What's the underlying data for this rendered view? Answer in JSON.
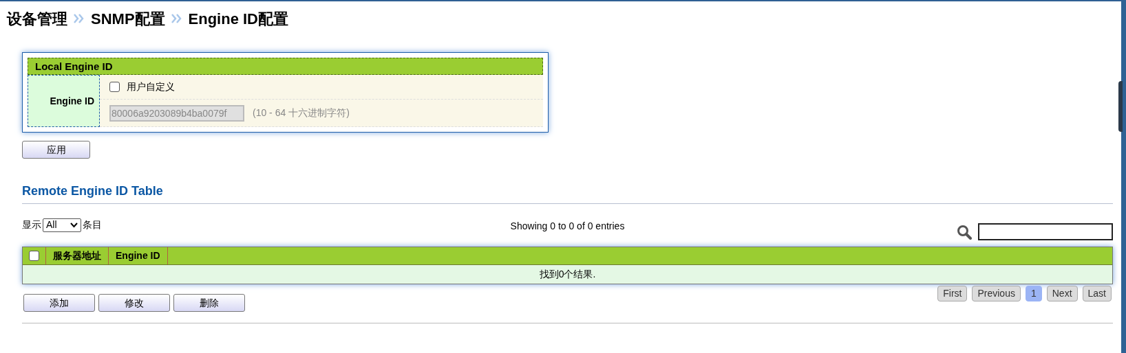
{
  "breadcrumb": [
    "设备管理",
    "SNMP配置",
    "Engine ID配置"
  ],
  "local_engine": {
    "title": "Local Engine ID",
    "field_label": "Engine ID",
    "custom": {
      "label": "用户自定义",
      "checked": false
    },
    "engine_id": {
      "value": "80006a9203089b4ba0079f",
      "disabled": true
    },
    "hint": "(10 - 64 十六进制字符)"
  },
  "apply_button": "应用",
  "remote_table": {
    "title": "Remote Engine ID Table",
    "page_length": {
      "before": "显示",
      "value": "All",
      "after": "条目"
    },
    "info": "Showing 0 to 0 of 0 entries",
    "columns": [
      {
        "kind": "checkbox",
        "checked": false
      },
      {
        "kind": "text",
        "label": "服务器地址"
      },
      {
        "kind": "text",
        "label": "Engine ID"
      }
    ],
    "empty_message": "找到0个结果.",
    "buttons": [
      "添加",
      "修改",
      "删除"
    ],
    "pagination": [
      {
        "label": "First",
        "selected": false
      },
      {
        "label": "Previous",
        "selected": false
      },
      {
        "label": "1",
        "selected": true
      },
      {
        "label": "Next",
        "selected": false
      },
      {
        "label": "Last",
        "selected": false
      }
    ]
  }
}
